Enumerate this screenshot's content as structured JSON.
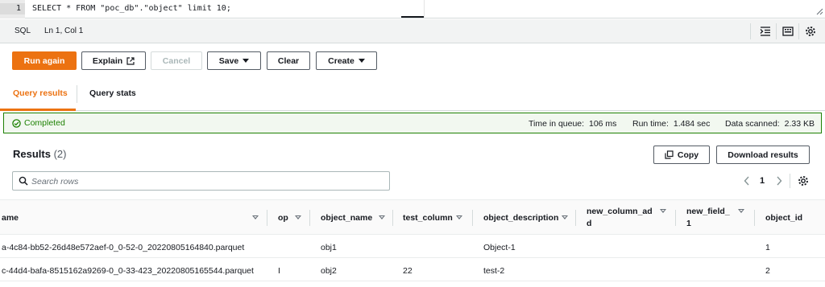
{
  "editor": {
    "line_number": "1",
    "code": "SELECT * FROM \"poc_db\".\"object\" limit 10;"
  },
  "statusbar": {
    "language": "SQL",
    "position": "Ln 1, Col 1",
    "icons": [
      "format-icon",
      "keyboard-icon",
      "settings-icon"
    ]
  },
  "toolbar": {
    "run_again": "Run again",
    "explain": "Explain",
    "cancel": "Cancel",
    "save": "Save",
    "clear": "Clear",
    "create": "Create"
  },
  "tabs": [
    {
      "label": "Query results",
      "active": true
    },
    {
      "label": "Query stats",
      "active": false
    }
  ],
  "status": {
    "text": "Completed",
    "queue_label": "Time in queue:",
    "queue_value": "106 ms",
    "run_label": "Run time:",
    "run_value": "1.484 sec",
    "scanned_label": "Data scanned:",
    "scanned_value": "2.33 KB",
    "color": "#1d8102"
  },
  "results": {
    "title": "Results",
    "count": "(2)",
    "copy_label": "Copy",
    "download_label": "Download results",
    "search_placeholder": "Search rows",
    "page": "1"
  },
  "table": {
    "columns": [
      "ame",
      "op",
      "object_name",
      "test_column",
      "object_description",
      "new_column_ad\nd",
      "new_field_\n1",
      "object_id"
    ],
    "rows": [
      [
        "a-4c84-bb52-26d48e572aef-0_0-52-0_20220805164840.parquet",
        "",
        "obj1",
        "",
        "Object-1",
        "",
        "",
        "1"
      ],
      [
        "c-44d4-bafa-8515162a9269-0_0-33-423_20220805165544.parquet",
        "I",
        "obj2",
        "22",
        "test-2",
        "",
        "",
        "2"
      ]
    ]
  },
  "colors": {
    "accent": "#ec7211",
    "success": "#1d8102"
  }
}
